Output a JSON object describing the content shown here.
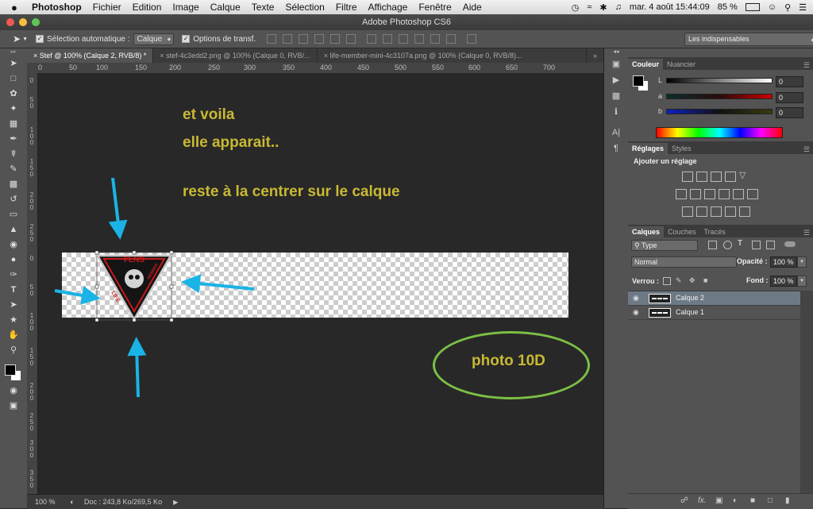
{
  "menubar": {
    "apple": "",
    "items": [
      "Photoshop",
      "Fichier",
      "Edition",
      "Image",
      "Calque",
      "Texte",
      "Sélection",
      "Filtre",
      "Affichage",
      "Fenêtre",
      "Aide"
    ],
    "clock": "mar. 4 août  15:44:09",
    "battery": "85 %"
  },
  "window": {
    "title": "Adobe Photoshop CS6"
  },
  "options": {
    "auto_select_label": "Sélection automatique :",
    "auto_select_value": "Calque",
    "transform_label": "Options de transf.",
    "workspace": "Les indispensables"
  },
  "tabs": [
    "Stef @ 100% (Calque 2, RVB/8) *",
    "stef-4c3edd2.png @ 100% (Calque 0, RVB/...",
    "life-member-mini-4c3107a.png @ 100% (Calque 0, RVB/8)..."
  ],
  "ruler": {
    "h": [
      "0",
      "50",
      "100",
      "150",
      "200",
      "250",
      "300",
      "350",
      "400",
      "450",
      "500",
      "550",
      "600",
      "650",
      "700"
    ],
    "v": [
      "0",
      "5 0",
      "1 0 0",
      "1 5 0",
      "2 0 0",
      "2 5 0",
      "0",
      "5 0",
      "1 0 0",
      "1 5 0",
      "2 0 0",
      "2 5 0",
      "3 0 0",
      "3 5 0"
    ]
  },
  "canvas": {
    "annotations": [
      "et voila",
      "elle apparait..",
      "reste à la centrer sur le calque"
    ],
    "logo_text": [
      "FLNS",
      "LIFE",
      "MEMBER"
    ],
    "circle_note": "photo 10D",
    "colors": {
      "annotation": "#c9b933",
      "arrow": "#1ab3e6",
      "ellipse": "#7cbf45"
    }
  },
  "status": {
    "zoom": "100 %",
    "doc": "Doc : 243,8 Ko/269,5 Ko"
  },
  "color_panel": {
    "tabs": [
      "Couleur",
      "Nuancier"
    ],
    "channels": [
      {
        "label": "L",
        "value": "0"
      },
      {
        "label": "a",
        "value": "0"
      },
      {
        "label": "b",
        "value": "0"
      }
    ]
  },
  "adjust_panel": {
    "tabs": [
      "Réglages",
      "Styles"
    ],
    "heading": "Ajouter un réglage"
  },
  "layers_panel": {
    "tabs": [
      "Calques",
      "Couches",
      "Tracés"
    ],
    "filter": "Type",
    "blend": "Normal",
    "opacity_label": "Opacité :",
    "opacity": "100 %",
    "lock_label": "Verrou :",
    "fill_label": "Fond :",
    "fill": "100 %",
    "layers": [
      {
        "name": "Calque 2",
        "selected": true
      },
      {
        "name": "Calque 1",
        "selected": false
      }
    ]
  }
}
